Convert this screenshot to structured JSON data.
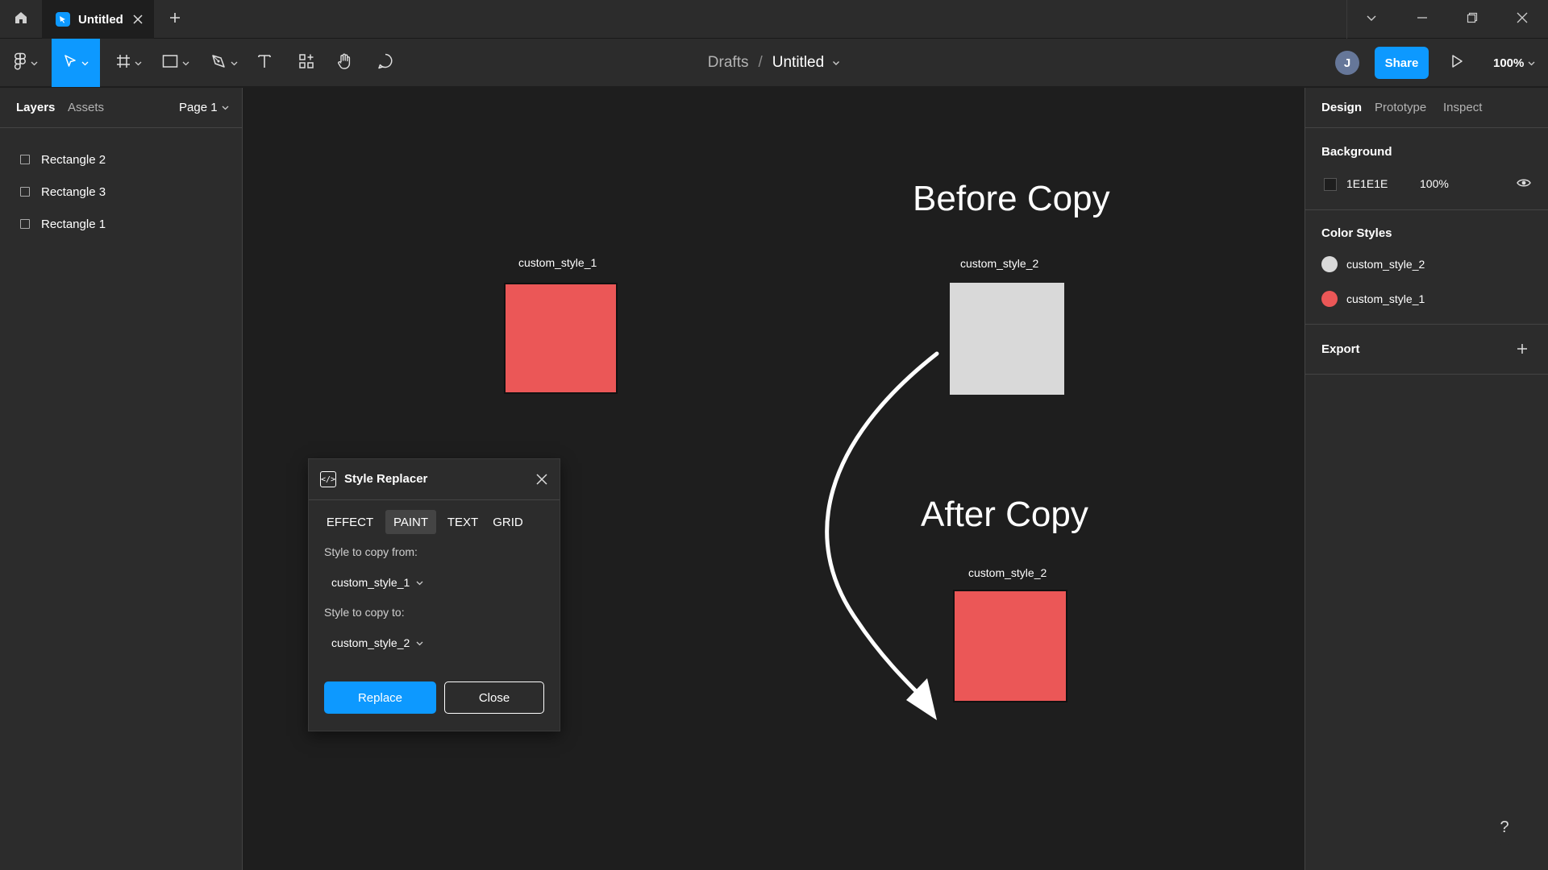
{
  "titlebar": {
    "tab_title": "Untitled",
    "icons": [
      "home-icon",
      "close-icon",
      "plus-icon",
      "chevron-down-icon",
      "minimize-icon",
      "restore-icon",
      "window-close-icon"
    ]
  },
  "toolbar": {
    "breadcrumb_parent": "Drafts",
    "breadcrumb_sep": "/",
    "file_name": "Untitled",
    "avatar_initial": "J",
    "share_label": "Share",
    "zoom": "100%",
    "tools": [
      "main-menu",
      "move",
      "frame",
      "shape",
      "pen",
      "text",
      "resources",
      "hand",
      "comment"
    ],
    "accent": "#0d99ff"
  },
  "left_panel": {
    "tabs": {
      "layers": "Layers",
      "assets": "Assets"
    },
    "page": "Page 1",
    "layers": [
      {
        "label": "Rectangle 2"
      },
      {
        "label": "Rectangle 3"
      },
      {
        "label": "Rectangle 1"
      }
    ]
  },
  "canvas": {
    "background": "#1e1e1e",
    "heading_before": "Before Copy",
    "heading_after": "After Copy",
    "rect1_label": "custom_style_1",
    "rect2_label": "custom_style_2",
    "rect3_label": "custom_style_2",
    "red": "#eb5757",
    "grey": "#d9d9d9"
  },
  "plugin": {
    "title": "Style Replacer",
    "tabs": [
      "EFFECT",
      "PAINT",
      "TEXT",
      "GRID"
    ],
    "active_tab": "PAINT",
    "from_label": "Style to copy from:",
    "from_value": "custom_style_1",
    "to_label": "Style to copy to:",
    "to_value": "custom_style_2",
    "replace_label": "Replace",
    "close_label": "Close"
  },
  "right_panel": {
    "tabs": {
      "design": "Design",
      "prototype": "Prototype",
      "inspect": "Inspect"
    },
    "background_title": "Background",
    "bg_hex": "1E1E1E",
    "bg_opacity": "100%",
    "color_styles_title": "Color Styles",
    "color_styles": [
      {
        "label": "custom_style_2",
        "color": "#d9d9d9"
      },
      {
        "label": "custom_style_1",
        "color": "#eb5757"
      }
    ],
    "export_title": "Export"
  },
  "help_label": "?"
}
